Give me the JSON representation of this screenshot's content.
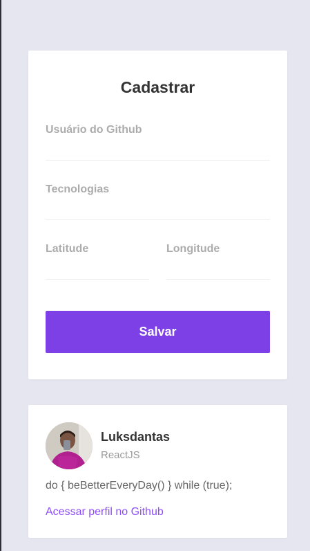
{
  "form": {
    "title": "Cadastrar",
    "github_username_label": "Usuário do Github",
    "github_username_value": "",
    "techs_label": "Tecnologias",
    "techs_value": "",
    "latitude_label": "Latitude",
    "latitude_value": "",
    "longitude_label": "Longitude",
    "longitude_value": "",
    "save_label": "Salvar"
  },
  "dev": {
    "name": "Luksdantas",
    "techs": "ReactJS",
    "bio": "do { beBetterEveryDay() } while (true);",
    "profile_link_label": "Acessar perfil no Github"
  },
  "colors": {
    "background": "#e6e6f0",
    "accent": "#7d40e7",
    "link": "#8e4dff"
  }
}
